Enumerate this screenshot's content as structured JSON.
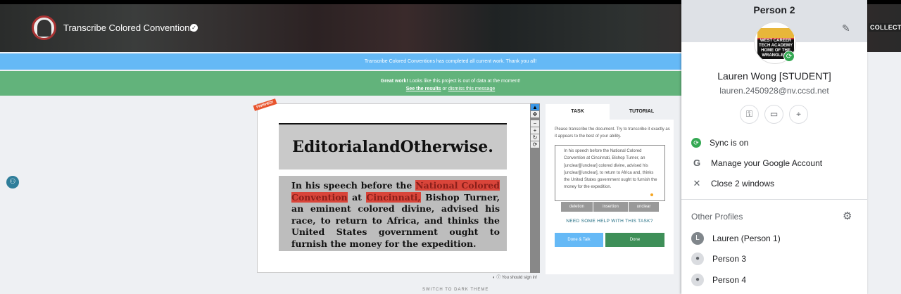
{
  "header": {
    "title": "Transcribe Colored Conventions",
    "nav_item": "COLLECT"
  },
  "banners": {
    "info": "Transcribe Colored Conventions has completed all current work. Thank you all!",
    "success_bold": "Great work!",
    "success_text": " Looks like this project is out of data at the moment!",
    "see_results": "See the results",
    "or": " or ",
    "dismiss": "dismiss this message"
  },
  "viewer": {
    "badge": "FINISHED!",
    "headline": "EditorialandOtherwise.",
    "article": [
      "In his speech before the ",
      "National Colored Convention",
      " at ",
      "Cincinnati,",
      " Bishop Turner, an eminent colored divine, advised his race, to return to Africa, and thinks the United States government ought to furnish the money for the expedition."
    ],
    "toolbar": [
      "▲",
      "✥",
      "−",
      "+",
      "↻",
      "⟳"
    ],
    "signin": "You should sign in!"
  },
  "task": {
    "tabs": [
      "TASK",
      "TUTORIAL"
    ],
    "instructions": "Please transcribe the document. Try to transcribe it exactly as it appears to the best of your ability.",
    "transcription": "In his speech before the National Colored Convention at Cincinnati, Bishop Turner, an  [unclear][/unclear] colored divine, advised his [unclear][/unclear], to return to Africa and, thinks the United States government ought to furnish the money for the expedition.",
    "tag_buttons": [
      "deletion",
      "insertion",
      "unclear"
    ],
    "help": "NEED SOME HELP WITH THIS TASK?",
    "done_talk": "Done & Talk",
    "done": "Done"
  },
  "footer": {
    "dark_theme": "SWITCH TO DARK THEME"
  },
  "profile_panel": {
    "profile_name": "Person 2",
    "user_name": "Lauren Wong [STUDENT]",
    "email": "lauren.2450928@nv.ccsd.net",
    "avatar_text": "WEST CAREER TECH ACADEMY HOME OF THE WRANGLERS",
    "menu": [
      "Sync is on",
      "Manage your Google Account",
      "Close 2 windows"
    ],
    "other_profiles_label": "Other Profiles",
    "profiles": [
      {
        "initial": "L",
        "name": "Lauren (Person 1)"
      },
      {
        "name": "Person 3"
      },
      {
        "name": "Person 4"
      }
    ]
  }
}
